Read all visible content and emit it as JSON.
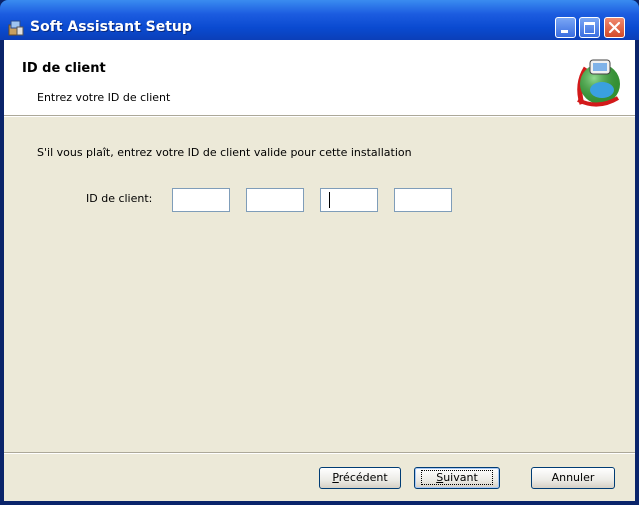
{
  "window": {
    "title": "Soft Assistant Setup"
  },
  "banner": {
    "title": "ID de client",
    "subtitle": "Entrez votre ID de client",
    "logo_icon": "globe-logo-icon"
  },
  "main": {
    "instruction": "S'il vous plaît, entrez votre ID de client valide pour cette installation",
    "field_label": "ID de client:",
    "id_fields": [
      "",
      "",
      "",
      ""
    ]
  },
  "buttons": {
    "prev_accel": "P",
    "prev_rest": "récédent",
    "next_accel": "S",
    "next_rest": "uivant",
    "cancel": "Annuler"
  },
  "colors": {
    "titlebar": "#0a4ad0",
    "dialog_bg": "#ece9d8",
    "field_border": "#7f9db9",
    "close_button": "#d24a28"
  }
}
